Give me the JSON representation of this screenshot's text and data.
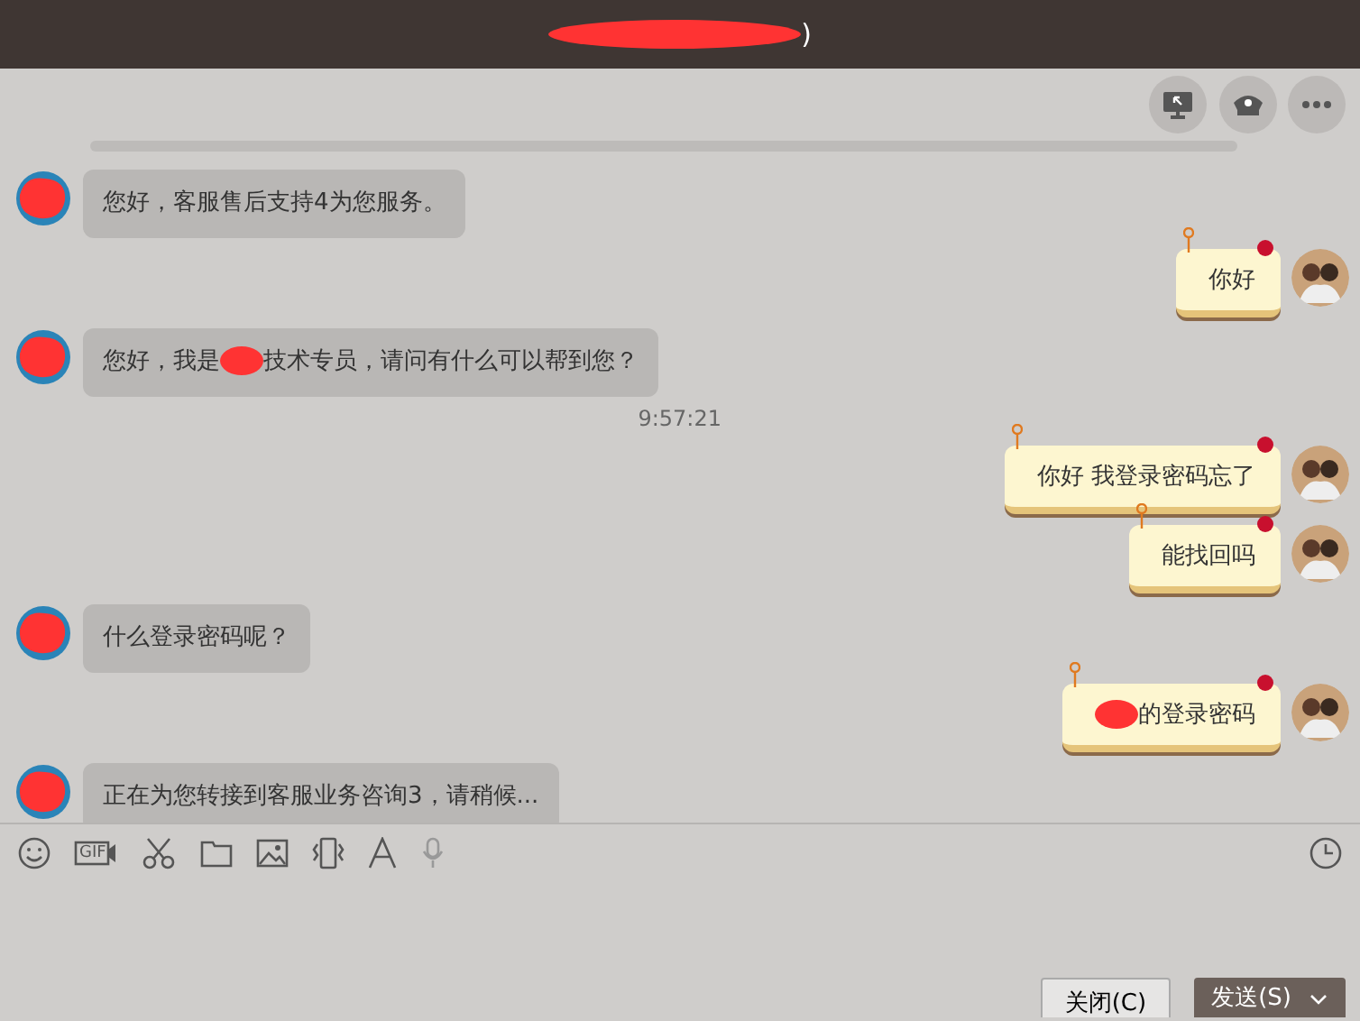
{
  "window": {
    "title": ")"
  },
  "messages": [
    {
      "kind": "incoming",
      "parts": [
        {
          "kind": "text",
          "text": "您好，客服售后支持4为您服务。"
        }
      ]
    },
    {
      "kind": "outgoing",
      "parts": [
        {
          "kind": "text",
          "text": "你好"
        }
      ]
    },
    {
      "kind": "incoming",
      "parts": [
        {
          "kind": "text",
          "text": "您好，我是"
        },
        {
          "kind": "redacted"
        },
        {
          "kind": "text",
          "text": "技术专员，请问有什么可以帮到您？"
        }
      ]
    },
    {
      "kind": "time",
      "text": "9:57:21"
    },
    {
      "kind": "outgoing",
      "parts": [
        {
          "kind": "text",
          "text": "你好 我登录密码忘了"
        }
      ]
    },
    {
      "kind": "outgoing",
      "parts": [
        {
          "kind": "text",
          "text": "能找回吗"
        }
      ]
    },
    {
      "kind": "incoming",
      "parts": [
        {
          "kind": "text",
          "text": "什么登录密码呢？"
        }
      ]
    },
    {
      "kind": "outgoing",
      "parts": [
        {
          "kind": "redacted"
        },
        {
          "kind": "text",
          "text": "的登录密码"
        }
      ]
    },
    {
      "kind": "incoming",
      "parts": [
        {
          "kind": "text",
          "text": "正在为您转接到客服业务咨询3，请稍候..."
        }
      ]
    }
  ],
  "toolbar": {
    "gif_label": "GIF"
  },
  "buttons": [
    {
      "kind": "close",
      "label": "关闭(C)"
    },
    {
      "kind": "send",
      "label": "发送(S)"
    }
  ]
}
